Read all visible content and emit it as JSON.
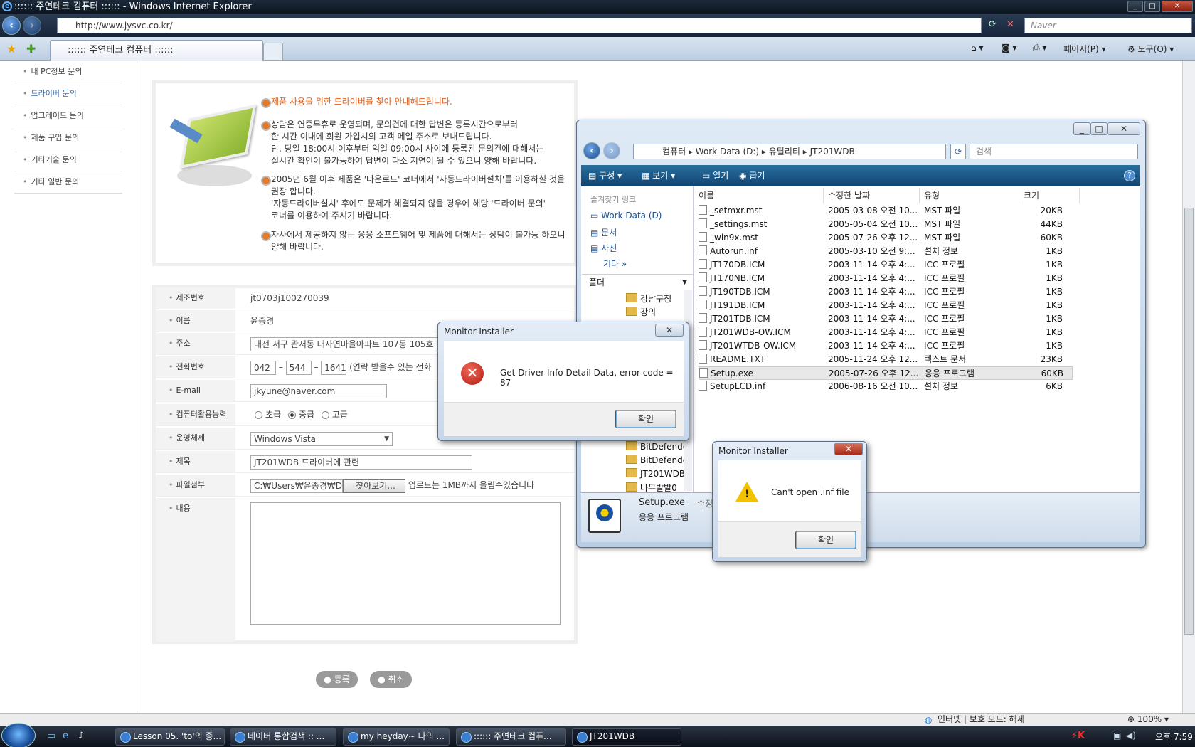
{
  "browser": {
    "title": ":::::: 주연테크 컴퓨터 :::::: - Windows Internet Explorer",
    "address": "http://www.jysvc.co.kr/",
    "search_placeholder": "Naver",
    "tab_label": ":::::: 주연테크 컴퓨터 ::::::",
    "cmd_page": "페이지(P)",
    "cmd_tools": "도구(O)"
  },
  "sidebar": {
    "items": [
      {
        "label": "내 PC정보 문의"
      },
      {
        "label": "드라이버 문의"
      },
      {
        "label": "업그레이드 문의"
      },
      {
        "label": "제품 구입 문의"
      },
      {
        "label": "기타기술 문의"
      },
      {
        "label": "기타 일반 문의"
      }
    ],
    "active_color": "#2a6fbf"
  },
  "info": {
    "p1": "제품 사용을 위한 드라이버를 찾아 안내해드립니다.",
    "p2_l1": "상담은 연중무휴로 운영되며, 문의건에 대한 답변은 등록시간으로부터",
    "p2_l2": "한 시간 이내에 회원 가입시의 고객 메일 주소로 보내드립니다.",
    "p2_l3": "단, 당일 18:00시 이후부터 익일 09:00시 사이에 등록된 문의건에 대해서는",
    "p2_l4": "실시간 확인이 불가능하여 답변이 다소 지연이 될 수 있으니 양해 바랍니다.",
    "p3_l1": "2005년 6월 이후 제품은 '다운로드' 코너에서 '자동드라이버설치'를 이용하실 것을",
    "p3_l2": "권장 합니다.",
    "p3_l3": "'자동드라이버설치' 후에도 문제가 해결되지 않을 경우에 해당 '드라이버 문의'",
    "p3_l4": "코너를 이용하여 주시기 바랍니다.",
    "p4_l1": "자사에서 제공하지 않는 응용 소프트웨어 및 제품에 대해서는 상담이 불가능 하오니",
    "p4_l2": "양해 바랍니다.",
    "accent": "#e0601a"
  },
  "form": {
    "serial_label": "제조번호",
    "serial_value": "jt0703j100270039",
    "name_label": "이름",
    "name_value": "윤종경",
    "addr_label": "주소",
    "addr_value": "대전 서구 관저동  대자연마을아파트 107동 105호",
    "phone_label": "전화번호",
    "phone1": "042",
    "phone2": "544",
    "phone3": "1641",
    "phone_note": "(연락 받을수 있는 전화",
    "email_label": "E-mail",
    "email_value": "jkyune@naver.com",
    "skill_label": "컴퓨터활용능력",
    "skill_opt1": "초급",
    "skill_opt2": "중급",
    "skill_opt3": "고급",
    "os_label": "운영체제",
    "os_value": "Windows Vista",
    "subject_label": "제목",
    "subject_value": "JT201WDB 드라이버에 관련",
    "file_label": "파일첨부",
    "file_value": "C:₩Users₩윤종경₩De",
    "file_browse": "찾아보기...",
    "file_note": "업로드는 1MB까지 올림수있습니다",
    "content_label": "내용",
    "submit_label": "등록",
    "cancel_label": "취소"
  },
  "explorer": {
    "path_1": "컴퓨터",
    "path_2": "Work Data (D:)",
    "path_3": "유틸리티",
    "path_4": "JT201WDB",
    "search_placeholder": "검색",
    "cmd_organize": "구성",
    "cmd_view": "보기",
    "cmd_open": "열기",
    "cmd_burn": "굽기",
    "fav_header": "즐겨찾기 링크",
    "fav_items": [
      "Work Data (D)",
      "문서",
      "사진",
      "기타"
    ],
    "folders_header": "폴더",
    "folders_top": [
      "강남구청",
      "강의"
    ],
    "folders_bottom": [
      "BitDefende",
      "BitDefende",
      "JT201WDB",
      "나무발발0"
    ],
    "col_name": "이름",
    "col_date": "수정한 날짜",
    "col_type": "유형",
    "col_size": "크기",
    "files": [
      {
        "name": "_setmxr.mst",
        "date": "2005-03-08 오전 10...",
        "type": "MST 파일",
        "size": "20KB"
      },
      {
        "name": "_settings.mst",
        "date": "2005-05-04 오전 10...",
        "type": "MST 파일",
        "size": "44KB"
      },
      {
        "name": "_win9x.mst",
        "date": "2005-07-26 오후 12...",
        "type": "MST 파일",
        "size": "60KB"
      },
      {
        "name": "Autorun.inf",
        "date": "2005-03-10 오전 9:...",
        "type": "설치 정보",
        "size": "1KB"
      },
      {
        "name": "JT170DB.ICM",
        "date": "2003-11-14 오후 4:...",
        "type": "ICC 프로필",
        "size": "1KB"
      },
      {
        "name": "JT170NB.ICM",
        "date": "2003-11-14 오후 4:...",
        "type": "ICC 프로필",
        "size": "1KB"
      },
      {
        "name": "JT190TDB.ICM",
        "date": "2003-11-14 오후 4:...",
        "type": "ICC 프로필",
        "size": "1KB"
      },
      {
        "name": "JT191DB.ICM",
        "date": "2003-11-14 오후 4:...",
        "type": "ICC 프로필",
        "size": "1KB"
      },
      {
        "name": "JT201TDB.ICM",
        "date": "2003-11-14 오후 4:...",
        "type": "ICC 프로필",
        "size": "1KB"
      },
      {
        "name": "JT201WDB-OW.ICM",
        "date": "2003-11-14 오후 4:...",
        "type": "ICC 프로필",
        "size": "1KB"
      },
      {
        "name": "JT201WTDB-OW.ICM",
        "date": "2003-11-14 오후 4:...",
        "type": "ICC 프로필",
        "size": "1KB"
      },
      {
        "name": "README.TXT",
        "date": "2005-11-24 오후 12...",
        "type": "텍스트 문서",
        "size": "23KB"
      },
      {
        "name": "Setup.exe",
        "date": "2005-07-26 오후 12...",
        "type": "응용 프로그램",
        "size": "60KB"
      },
      {
        "name": "SetupLCD.inf",
        "date": "2006-08-16 오전 10...",
        "type": "설치 정보",
        "size": "6KB"
      }
    ],
    "detail_name": "Setup.exe",
    "detail_type": "응용 프로그램",
    "detail_mod": "수정"
  },
  "dialog1": {
    "title": "Monitor Installer",
    "message": "Get Driver Info Detail Data, error code = 87",
    "ok": "확인"
  },
  "dialog2": {
    "title": "Monitor Installer",
    "message": "Can't open .inf file",
    "ok": "확인"
  },
  "status": {
    "zone": "인터넷 | 보호 모드: 해제",
    "zoom": "100%"
  },
  "taskbar": {
    "items": [
      "Lesson 05. 'to'의 종...",
      "네이버 통합검색 :: ...",
      "my heyday~ 나의 ...",
      ":::::: 주연테크 컴퓨...",
      "JT201WDB"
    ],
    "clock": "오후 7:59"
  }
}
